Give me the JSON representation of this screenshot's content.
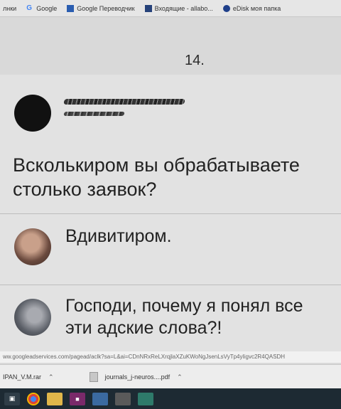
{
  "bookmarks": [
    {
      "label": "лнки",
      "icon": "apps-icon"
    },
    {
      "label": "Google",
      "icon": "google-icon"
    },
    {
      "label": "Google Переводчик",
      "icon": "translate-icon"
    },
    {
      "label": "Входящие - allabo...",
      "icon": "mail-icon"
    },
    {
      "label": "eDisk моя папка",
      "icon": "disk-icon"
    }
  ],
  "page_number": "14.",
  "post": {
    "question": "Всколькиром вы обрабатываете столько заявок?"
  },
  "answers": [
    {
      "text": "Вдивитиром."
    },
    {
      "text": "Господи, почему я понял все эти адские слова?!"
    }
  ],
  "status_url": "ww.googleadservices.com/pagead/aclk?sa=L&ai=CDnNRxReLXrqjlaXZuKWoNgJsenLsVyTp4yIigvc2R4QASDH",
  "downloads": [
    {
      "name": "IPAN_V.M.rar"
    },
    {
      "name": "journals_j-neuros....pdf"
    }
  ],
  "colors": {
    "taskbar": "#1d2a33",
    "card_background": "#e2e2e2"
  }
}
